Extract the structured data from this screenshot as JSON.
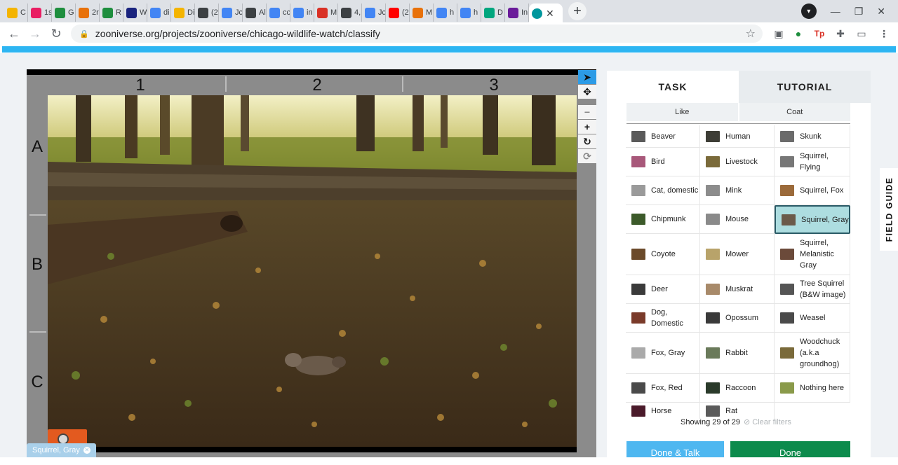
{
  "browser": {
    "tabs": [
      {
        "label": "C",
        "icon": "classroom-icon",
        "color": "#f4b400"
      },
      {
        "label": "1s",
        "icon": "classroom-icon",
        "color": "#e91e63"
      },
      {
        "label": "G",
        "icon": "leaf-icon",
        "color": "#1e8e3e"
      },
      {
        "label": "2r",
        "icon": "classroom-icon",
        "color": "#e8710a"
      },
      {
        "label": "R",
        "icon": "classroom-icon",
        "color": "#1e8e3e"
      },
      {
        "label": "W",
        "icon": "swoosh-icon",
        "color": "#1a237e"
      },
      {
        "label": "di",
        "icon": "google-icon",
        "color": "#4285f4"
      },
      {
        "label": "Di",
        "icon": "slides-icon",
        "color": "#f4b400"
      },
      {
        "label": "(2",
        "icon": "classroom-icon",
        "color": "#3c4043"
      },
      {
        "label": "Jc",
        "icon": "docs-icon",
        "color": "#4285f4"
      },
      {
        "label": "Al",
        "icon": "classroom-icon",
        "color": "#3c4043"
      },
      {
        "label": "cc",
        "icon": "google-icon",
        "color": "#4285f4"
      },
      {
        "label": "in",
        "icon": "google-icon",
        "color": "#4285f4"
      },
      {
        "label": "M",
        "icon": "m-icon",
        "color": "#d93025"
      },
      {
        "label": "4,",
        "icon": "classroom-icon",
        "color": "#3c4043"
      },
      {
        "label": "Jc",
        "icon": "docs-icon",
        "color": "#4285f4"
      },
      {
        "label": "(2",
        "icon": "youtube-icon",
        "color": "#ff0000"
      },
      {
        "label": "M",
        "icon": "g-icon",
        "color": "#e8710a"
      },
      {
        "label": "h",
        "icon": "google-icon",
        "color": "#4285f4"
      },
      {
        "label": "h",
        "icon": "google-icon",
        "color": "#4285f4"
      },
      {
        "label": "D",
        "icon": "hex-icon",
        "color": "#00a67e"
      },
      {
        "label": "In",
        "icon": "dots-icon",
        "color": "#6a1b9a"
      }
    ],
    "active_tab": {
      "icon": "zooniverse-icon",
      "color": "#00979d"
    },
    "url": "zooniverse.org/projects/zooniverse/chicago-wildlife-watch/classify"
  },
  "viewer": {
    "columns": [
      "1",
      "2",
      "3"
    ],
    "rows": [
      "A",
      "B",
      "C"
    ],
    "mark_label": "Squirrel, Gray"
  },
  "task_panel": {
    "tab_task": "TASK",
    "tab_tutorial": "TUTORIAL",
    "filter_like": "Like",
    "filter_coat": "Coat",
    "choices": [
      {
        "label": "Beaver",
        "thumb": "#5a5a5a"
      },
      {
        "label": "Human",
        "thumb": "#3d3d36"
      },
      {
        "label": "Skunk",
        "thumb": "#6b6b6b"
      },
      {
        "label": "Bird",
        "thumb": "#a8587a"
      },
      {
        "label": "Livestock",
        "thumb": "#7a6a3a"
      },
      {
        "label": "Squirrel, Flying",
        "thumb": "#777777"
      },
      {
        "label": "Cat, domestic",
        "thumb": "#9a9a9a"
      },
      {
        "label": "Mink",
        "thumb": "#8c8c8c"
      },
      {
        "label": "Squirrel, Fox",
        "thumb": "#9b6a3a"
      },
      {
        "label": "Chipmunk",
        "thumb": "#3c5a2a"
      },
      {
        "label": "Mouse",
        "thumb": "#8a8a8a"
      },
      {
        "label": "Squirrel, Gray",
        "thumb": "#6b5a4a",
        "selected": true
      },
      {
        "label": "Coyote",
        "thumb": "#6b4a2a"
      },
      {
        "label": "Mower",
        "thumb": "#b8a36a"
      },
      {
        "label": "Squirrel, Melanistic Gray",
        "thumb": "#6b4a3a"
      },
      {
        "label": "Deer",
        "thumb": "#3a3a3a"
      },
      {
        "label": "Muskrat",
        "thumb": "#a88a6a"
      },
      {
        "label": "Tree Squirrel (B&W image)",
        "thumb": "#555555"
      },
      {
        "label": "Dog, Domestic",
        "thumb": "#7a3a2a"
      },
      {
        "label": "Opossum",
        "thumb": "#3a3a3a"
      },
      {
        "label": "Weasel",
        "thumb": "#4a4a4a"
      },
      {
        "label": "Fox, Gray",
        "thumb": "#aaaaaa"
      },
      {
        "label": "Rabbit",
        "thumb": "#6a7a5a"
      },
      {
        "label": "Woodchuck (a.k.a groundhog)",
        "thumb": "#7a6a3a"
      },
      {
        "label": "Fox, Red",
        "thumb": "#4a4a4a"
      },
      {
        "label": "Raccoon",
        "thumb": "#2a3a2a"
      },
      {
        "label": "Nothing here",
        "thumb": "#8a9a4a"
      },
      {
        "label": "Horse",
        "thumb": "#4a1a2a"
      },
      {
        "label": "Rat",
        "thumb": "#5a5a5a"
      }
    ],
    "showing_text": "Showing 29 of 29",
    "clear_filters": "Clear filters",
    "done_talk": "Done & Talk",
    "done": "Done"
  },
  "field_guide": "FIELD GUIDE"
}
